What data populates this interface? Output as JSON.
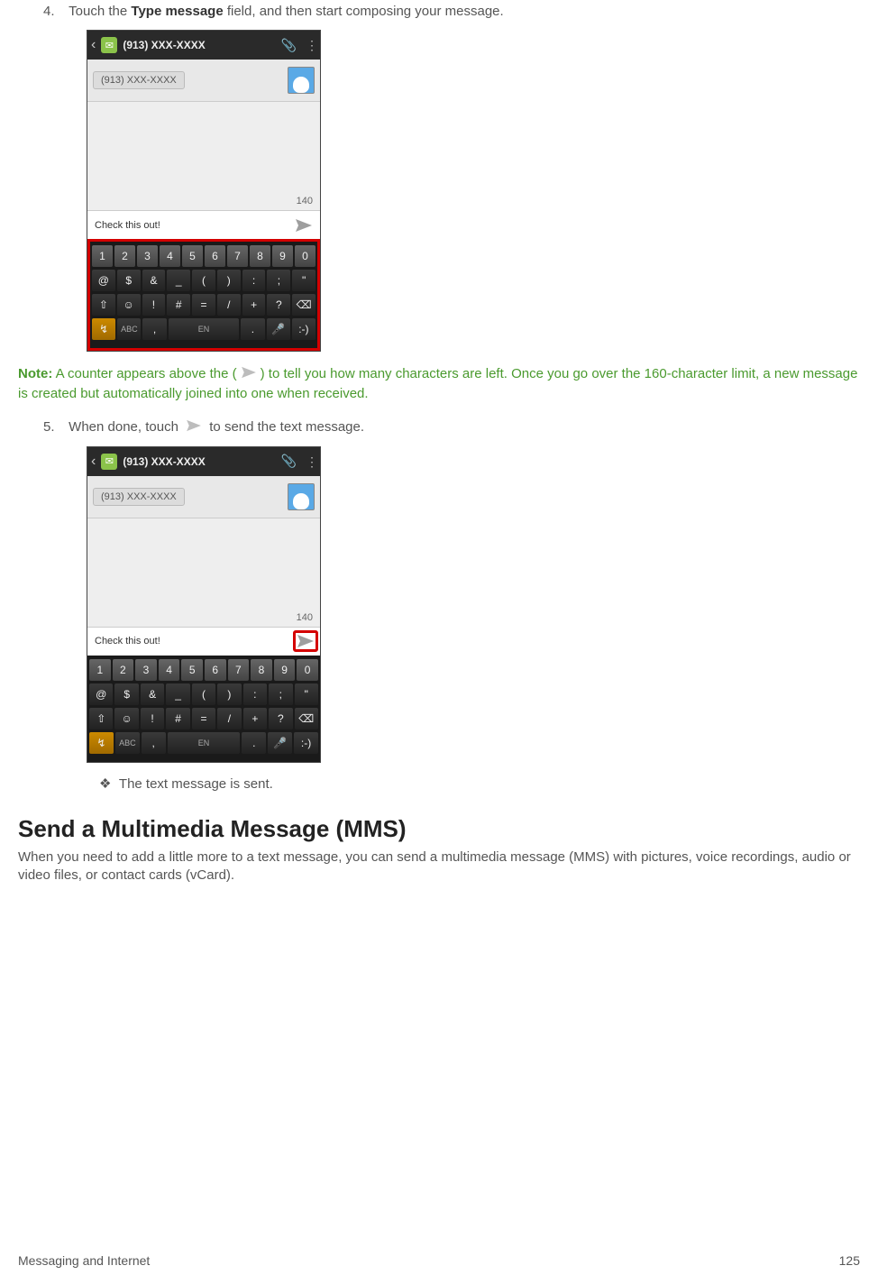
{
  "step4": {
    "num": "4.",
    "pre": "Touch the ",
    "bold": "Type message",
    "post": " field, and then start composing your message."
  },
  "note": {
    "label": "Note:",
    "pre": " A counter appears above the (",
    "post": ") to tell you how many characters are left. Once you go over the 160-character limit, a new message is created but automatically joined into one when received."
  },
  "step5": {
    "num": "5.",
    "pre": "When done, touch ",
    "post": " to send the text message."
  },
  "bullet": "The text message is sent.",
  "heading": "Send a Multimedia Message (MMS)",
  "heading_body": "When you need to add a little more to a text message, you can send a multimedia message (MMS) with pictures, voice recordings, audio or video files, or contact cards (vCard).",
  "footer_left": "Messaging and Internet",
  "footer_right": "125",
  "phone": {
    "title": "(913) XXX-XXXX",
    "chip": "(913) XXX-XXXX",
    "counter": "140",
    "input": "Check this out!",
    "keyboard": {
      "row1": [
        "1",
        "2",
        "3",
        "4",
        "5",
        "6",
        "7",
        "8",
        "9",
        "0"
      ],
      "row2": [
        "@",
        "$",
        "&",
        "_",
        "(",
        ")",
        ":",
        ";",
        "\""
      ],
      "row3": [
        "⇧",
        "☺",
        "!",
        "#",
        "=",
        "/",
        "+",
        "?",
        "⌫"
      ],
      "row4": [
        "↯",
        "ABC",
        ",",
        "EN",
        ".",
        "🎤",
        ":-)"
      ]
    }
  }
}
